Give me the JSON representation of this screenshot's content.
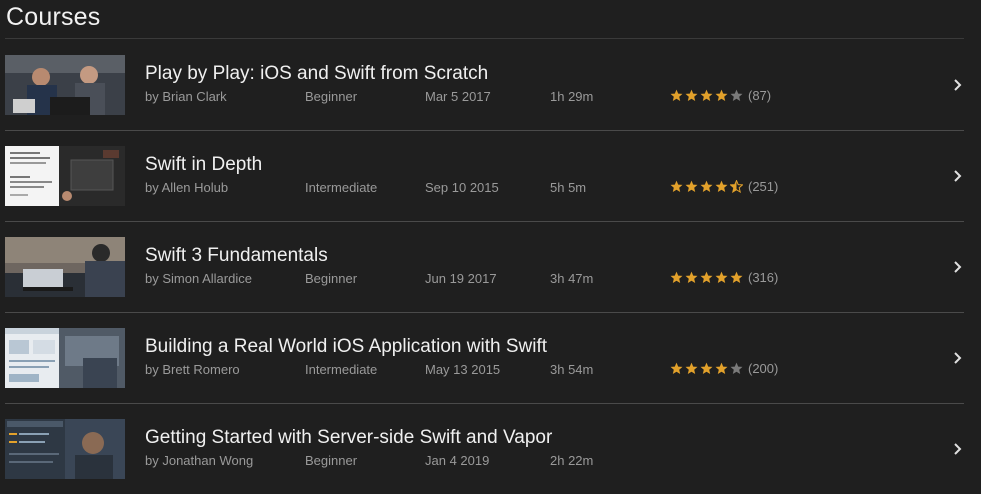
{
  "page": {
    "heading": "Courses"
  },
  "colors": {
    "star_filled": "#e2a12b",
    "star_empty": "#7a7a7a",
    "chevron": "#e0e0e0"
  },
  "courses": [
    {
      "title": "Play by Play: iOS and Swift from Scratch",
      "author": "by Brian Clark",
      "level": "Beginner",
      "date": "Mar 5 2017",
      "duration": "1h 29m",
      "rating": 4.0,
      "rating_count": "(87)"
    },
    {
      "title": "Swift in Depth",
      "author": "by Allen Holub",
      "level": "Intermediate",
      "date": "Sep 10 2015",
      "duration": "5h 5m",
      "rating": 4.5,
      "rating_count": "(251)"
    },
    {
      "title": "Swift 3 Fundamentals",
      "author": "by Simon Allardice",
      "level": "Beginner",
      "date": "Jun 19 2017",
      "duration": "3h 47m",
      "rating": 5.0,
      "rating_count": "(316)"
    },
    {
      "title": "Building a Real World iOS Application with Swift",
      "author": "by Brett Romero",
      "level": "Intermediate",
      "date": "May 13 2015",
      "duration": "3h 54m",
      "rating": 4.0,
      "rating_count": "(200)"
    },
    {
      "title": "Getting Started with Server-side Swift and Vapor",
      "author": "by Jonathan Wong",
      "level": "Beginner",
      "date": "Jan 4 2019",
      "duration": "2h 22m",
      "rating": null,
      "rating_count": ""
    }
  ]
}
